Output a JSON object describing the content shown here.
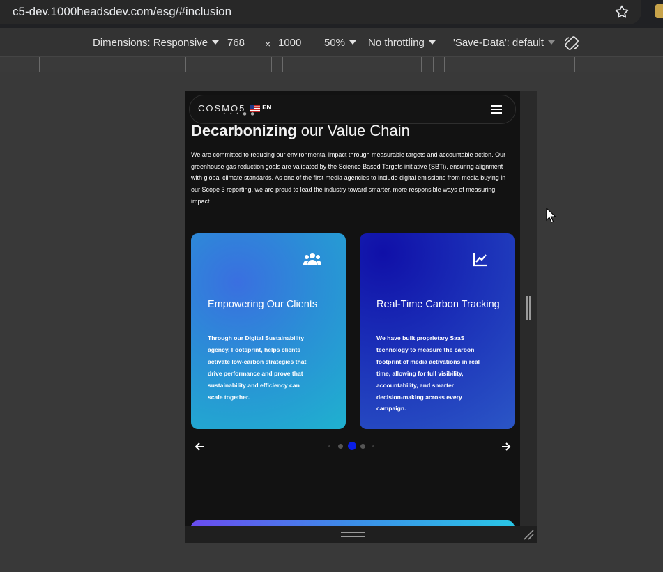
{
  "browser": {
    "url": "c5-dev.1000headsdev.com/esg/#inclusion"
  },
  "device_toolbar": {
    "dimensions_label": "Dimensions: Responsive",
    "width": "768",
    "times": "×",
    "height": "1000",
    "zoom": "50%",
    "throttling": "No throttling",
    "save_data": "'Save-Data': default"
  },
  "site": {
    "logo": "COSMO5",
    "language": "EN",
    "headline_bold": "Decarbonizing",
    "headline_rest": " our Value Chain",
    "intro": "We are committed to reducing our environmental impact through measurable targets and accountable action. Our greenhouse gas reduction goals are validated by the Science Based Targets initiative (SBTi), ensuring alignment with global climate standards. As one of the first media agencies to include digital emissions from media buying in our Scope 3 reporting, we are proud to lead the industry toward smarter, more responsible ways of measuring impact.",
    "cards": [
      {
        "icon": "users-icon",
        "title": "Empowering Our Clients",
        "body": "Through our Digital Sustainability agency, Footsprint, helps clients activate low-carbon strategies that drive performance and prove that sustainability and efficiency can scale together."
      },
      {
        "icon": "line-chart-icon",
        "title": "Real-Time Carbon Tracking",
        "body": "We have built proprietary SaaS technology to measure the carbon footprint of media activations in real time, allowing for full visibility, accountability, and smarter decision-making across every campaign."
      }
    ],
    "carousel": {
      "active_index": 2,
      "dot_count": 5,
      "active_color": "#0a1ee6"
    }
  }
}
